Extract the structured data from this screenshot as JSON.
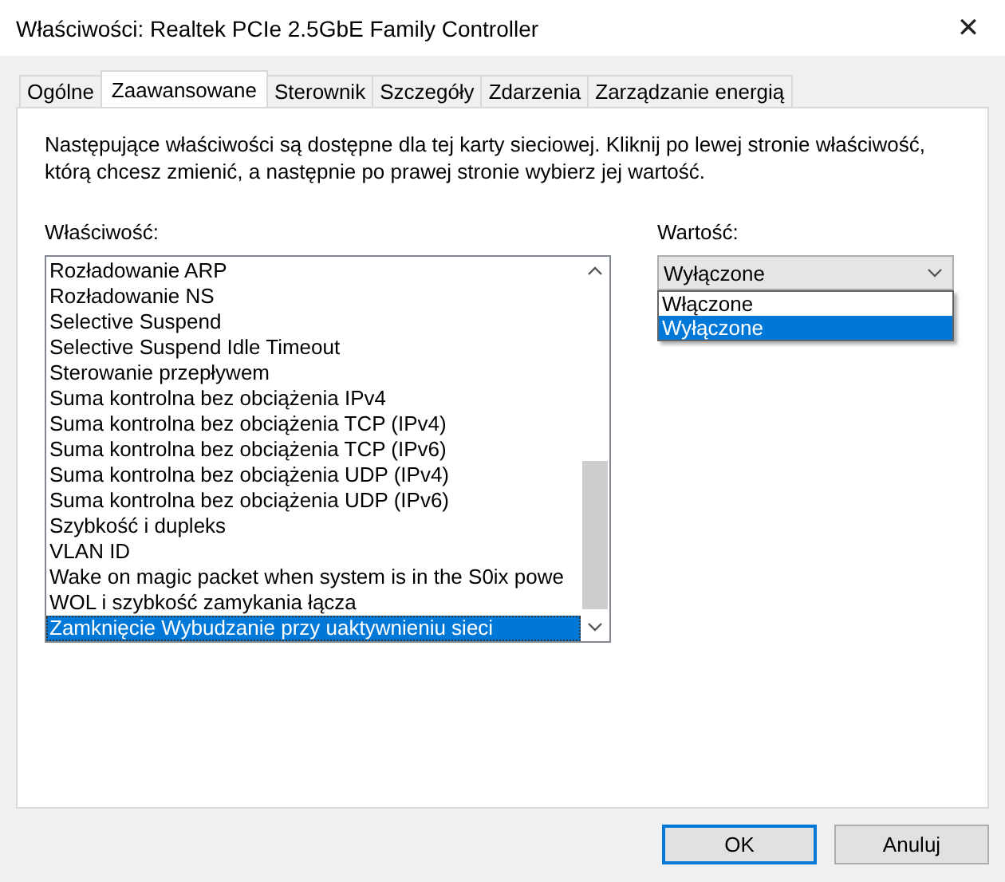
{
  "window": {
    "title": "Właściwości: Realtek PCIe 2.5GbE Family Controller",
    "close": "✕"
  },
  "tabs": [
    {
      "label": "Ogólne",
      "selected": false
    },
    {
      "label": "Zaawansowane",
      "selected": true
    },
    {
      "label": "Sterownik",
      "selected": false
    },
    {
      "label": "Szczegóły",
      "selected": false
    },
    {
      "label": "Zdarzenia",
      "selected": false
    },
    {
      "label": "Zarządzanie energią",
      "selected": false
    }
  ],
  "description": "Następujące właściwości są dostępne dla tej karty sieciowej. Kliknij po lewej stronie właściwość, którą chcesz zmienić, a następnie po prawej stronie wybierz jej wartość.",
  "property": {
    "label": "Właściwość:",
    "items": [
      {
        "label": "Rozładowanie ARP",
        "selected": false
      },
      {
        "label": "Rozładowanie NS",
        "selected": false
      },
      {
        "label": "Selective Suspend",
        "selected": false
      },
      {
        "label": "Selective Suspend Idle Timeout",
        "selected": false
      },
      {
        "label": "Sterowanie przepływem",
        "selected": false
      },
      {
        "label": "Suma kontrolna bez obciążenia IPv4",
        "selected": false
      },
      {
        "label": "Suma kontrolna bez obciążenia TCP (IPv4)",
        "selected": false
      },
      {
        "label": "Suma kontrolna bez obciążenia TCP (IPv6)",
        "selected": false
      },
      {
        "label": "Suma kontrolna bez obciążenia UDP (IPv4)",
        "selected": false
      },
      {
        "label": "Suma kontrolna bez obciążenia UDP (IPv6)",
        "selected": false
      },
      {
        "label": "Szybkość i dupleks",
        "selected": false
      },
      {
        "label": "VLAN ID",
        "selected": false
      },
      {
        "label": "Wake on magic packet when system is in the S0ix powe",
        "selected": false
      },
      {
        "label": "WOL i szybkość zamykania łącza",
        "selected": false
      },
      {
        "label": "Zamknięcie Wybudzanie przy uaktywnieniu sieci",
        "selected": true
      }
    ]
  },
  "value": {
    "label": "Wartość:",
    "current": "Wyłączone",
    "options": [
      {
        "label": "Włączone",
        "selected": false
      },
      {
        "label": "Wyłączone",
        "selected": true
      }
    ]
  },
  "buttons": [
    {
      "label": "OK",
      "default": true
    },
    {
      "label": "Anuluj",
      "default": false
    }
  ]
}
